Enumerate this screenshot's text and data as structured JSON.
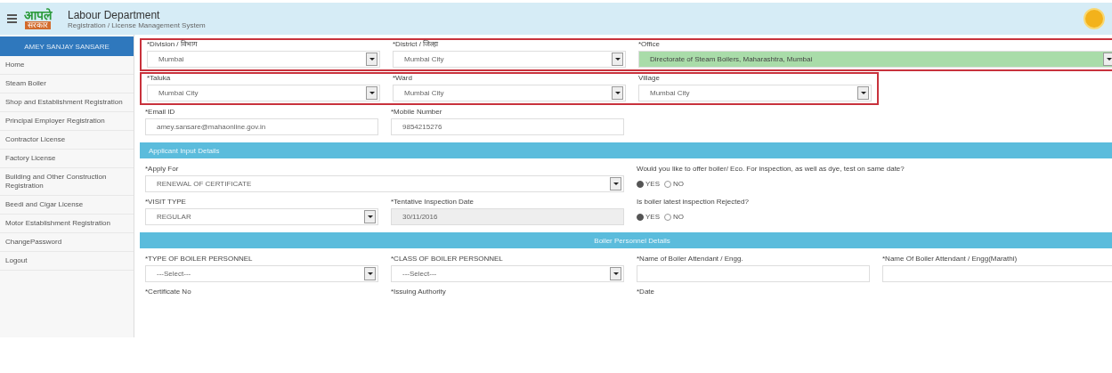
{
  "header": {
    "logo_top": "आपले",
    "logo_bottom": "सरकार",
    "title": "Labour Department",
    "subtitle": "Registration / License Management System"
  },
  "sidebar": {
    "user": "AMEY SANJAY SANSARE",
    "items": [
      {
        "label": "Home",
        "selected": false
      },
      {
        "label": "Steam Boiler",
        "selected": false
      },
      {
        "label": "Shop and Establishment Registration",
        "selected": false
      },
      {
        "label": "Principal Employer Registration",
        "selected": false
      },
      {
        "label": "Contractor License",
        "selected": false
      },
      {
        "label": "Factory License",
        "selected": false
      },
      {
        "label": "Building and Other Construction Registration",
        "selected": false
      },
      {
        "label": "Beedi and Cigar License",
        "selected": false
      },
      {
        "label": "Motor Establishment Registration",
        "selected": false
      },
      {
        "label": "ChangePassword",
        "selected": false
      },
      {
        "label": "Logout",
        "selected": false
      }
    ]
  },
  "form": [
    {
      "kind": "row",
      "outlined": true,
      "fields": [
        {
          "kind": "select",
          "label": "*Division / विभाग",
          "value": "Mumbai"
        },
        {
          "kind": "select",
          "label": "*District / जिल्हा",
          "value": "Mumbai City"
        },
        {
          "kind": "select",
          "label": "*Office",
          "value": "Directorate of Steam Boilers, Maharashtra, Mumbai",
          "wide": true,
          "highlighted": true
        }
      ]
    },
    {
      "kind": "row",
      "outlined": true,
      "fields": [
        {
          "kind": "select",
          "label": "*Taluka",
          "value": "Mumbai City"
        },
        {
          "kind": "select",
          "label": "*Ward",
          "value": "Mumbai City"
        },
        {
          "kind": "select",
          "label": "Village",
          "value": "Mumbai City"
        }
      ]
    },
    {
      "kind": "row",
      "outlined": false,
      "fields": [
        {
          "kind": "input",
          "label": "*Email ID",
          "value": "amey.sansare@mahaonline.gov.in"
        },
        {
          "kind": "input",
          "label": "*Mobile Number",
          "value": "9854215276"
        }
      ]
    },
    {
      "kind": "section",
      "title": "Applicant Input Details",
      "centered": false
    },
    {
      "kind": "row",
      "outlined": false,
      "fields": [
        {
          "kind": "select",
          "label": "*Apply For",
          "value": "RENEWAL OF CERTIFICATE",
          "wide": true
        },
        {
          "kind": "radio",
          "label": "Would you like to offer boiler/ Eco. For inspection, as well as dye, test on same date?",
          "options": [
            {
              "label": "YES",
              "selected": true
            },
            {
              "label": "NO",
              "selected": false
            }
          ]
        }
      ]
    },
    {
      "kind": "row",
      "outlined": false,
      "fields": [
        {
          "kind": "select",
          "label": "*VISIT TYPE",
          "value": "REGULAR"
        },
        {
          "kind": "input",
          "label": "*Tentative Inspection Date",
          "value": "30/11/2016",
          "disabled": true
        },
        {
          "kind": "radio",
          "label": "Is boiler latest inspection Rejected?",
          "options": [
            {
              "label": "YES",
              "selected": true
            },
            {
              "label": "NO",
              "selected": false
            }
          ]
        }
      ]
    },
    {
      "kind": "section",
      "title": "Boiler Personnel Details",
      "centered": true
    },
    {
      "kind": "row",
      "outlined": false,
      "fields": [
        {
          "kind": "select",
          "label": "*TYPE OF BOILER PERSONNEL",
          "value": "---Select---"
        },
        {
          "kind": "select",
          "label": "*CLASS OF BOILER PERSONNEL",
          "value": "---Select---"
        },
        {
          "kind": "input",
          "label": "*Name of Boiler Attendant / Engg."
        },
        {
          "kind": "input",
          "label": "*Name Of Boiler Attendant / Engg(Marathi)"
        }
      ]
    },
    {
      "kind": "row",
      "outlined": false,
      "fields": [
        {
          "kind": "label",
          "label": "*Certificate No"
        },
        {
          "kind": "label",
          "label": "*Issuing Authority"
        },
        {
          "kind": "label",
          "label": "*Date"
        }
      ]
    }
  ]
}
